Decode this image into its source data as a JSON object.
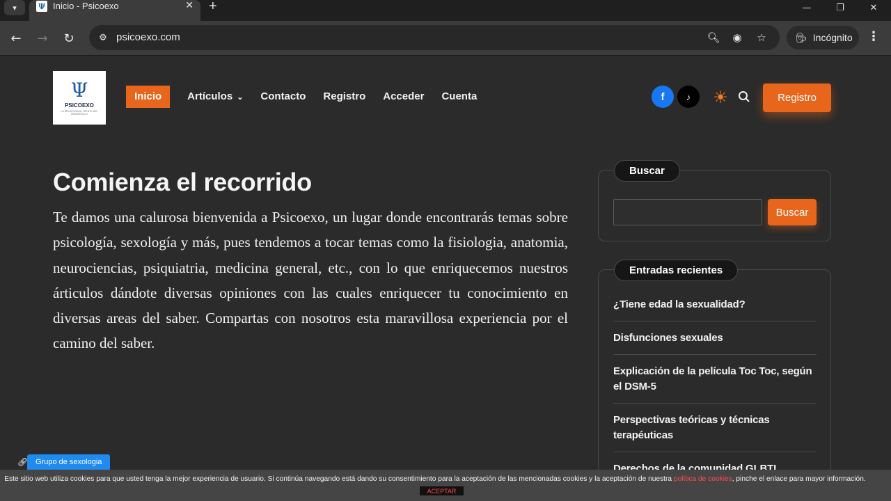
{
  "browser": {
    "tab_title": "Inicio - Psicoexo",
    "tab_close": "✕",
    "new_tab": "+",
    "url": "psicoexo.com",
    "profile_label": "Incógnito"
  },
  "site": {
    "logo_symbol": "Ψ",
    "logo_name": "PSICOEXO",
    "logo_tagline": "LA SEXOLOGÍA AL FRENTE DEL DESARROLLO",
    "nav": [
      {
        "label": "Inicio",
        "active": true
      },
      {
        "label": "Artículos",
        "has_dropdown": true
      },
      {
        "label": "Contacto"
      },
      {
        "label": "Registro"
      },
      {
        "label": "Acceder"
      },
      {
        "label": "Cuenta"
      }
    ],
    "social": {
      "facebook": "f",
      "tiktok": "♪"
    },
    "register_button": "Registro",
    "accent_color": "#e8651c"
  },
  "main": {
    "headline": "Comienza el recorrido",
    "intro": "Te damos una calurosa bienvenida a Psicoexo, un lugar donde encontrarás temas sobre psicología, sexología y más, pues tendemos a tocar temas como la fisiologia, anatomia, neurociencias, psiquiatria, medicina general, etc., con lo que enriquecemos nuestros árticulos dándote diversas opiniones con las cuales enriquecer tu conocimiento en diversas areas del saber. Compartas con nosotros esta maravillosa experiencia por el camino del saber."
  },
  "sidebar": {
    "search_title": "Buscar",
    "search_value": "",
    "search_button": "Buscar",
    "recent_title": "Entradas recientes",
    "recent_posts": [
      "¿Tiene edad la sexualidad?",
      "Disfunciones sexuales",
      "Explicación de la película Toc Toc, según el DSM-5",
      "Perspectivas teóricas y técnicas terapéuticas",
      "Derechos de la comunidad GLBTI"
    ]
  },
  "overlays": {
    "group_label": "Grupo de sexologia",
    "cookie_text_before": "Este sitio web utiliza cookies para que usted tenga la mejor experiencia de usuario. Si continúa navegando está dando su consentimiento para la aceptación de las mencionadas cookies y la aceptación de nuestra ",
    "cookie_link": "política de cookies",
    "cookie_text_after": ", pinche el enlace para mayor información.",
    "cookie_accept": "ACEPTAR"
  }
}
